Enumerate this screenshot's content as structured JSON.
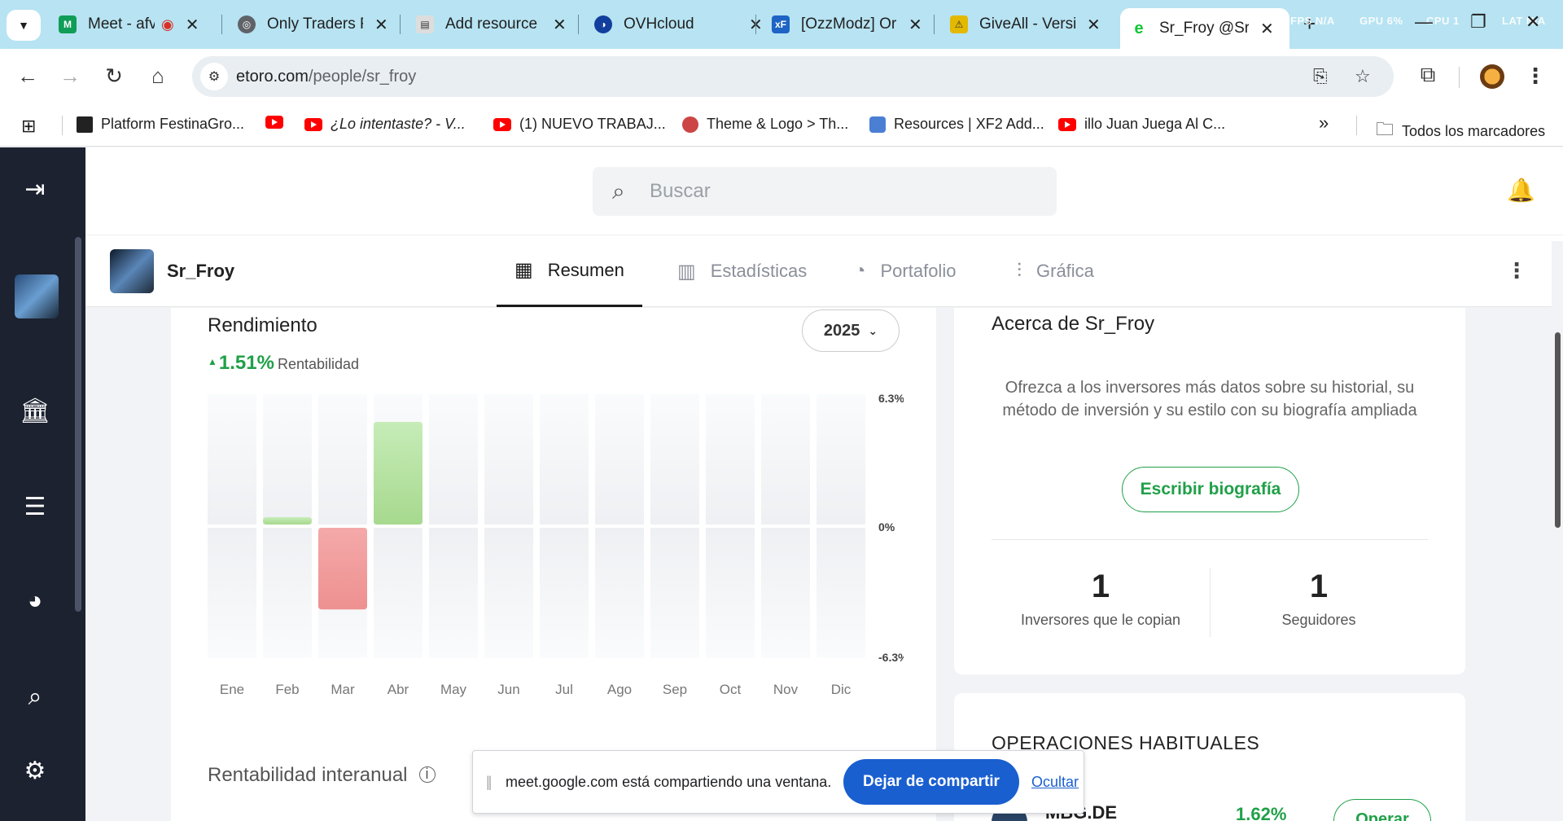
{
  "browser": {
    "tabs": [
      {
        "title": "Meet - afv",
        "color": "#0f9d58"
      },
      {
        "title": "Only Traders F",
        "color": "#5f6368"
      },
      {
        "title": "Add resource",
        "color": "#888888"
      },
      {
        "title": "OVHcloud",
        "color": "#123f9e"
      },
      {
        "title": "[OzzModz] Or",
        "color": "#1d64c4"
      },
      {
        "title": "GiveAll - Versi",
        "color": "#e3b900"
      },
      {
        "title": "Sr_Froy @Sr_F",
        "color": "#13c636"
      }
    ],
    "hud": {
      "fps": "FPS N/A",
      "gpu": "GPU  6%",
      "cpu": "CPU  1",
      "lat": "LAT N/A"
    },
    "url_host": "etoro.com",
    "url_path": "/people/sr_froy",
    "bookmarks": [
      "Platform FestinaGro...",
      "¿Lo intentaste? - V...",
      "(1) NUEVO TRABAJ...",
      "Theme & Logo > Th...",
      "Resources | XF2 Add...",
      "illo Juan Juega Al C..."
    ],
    "all_bookmarks": "Todos los marcadores",
    "overflow": "»"
  },
  "app": {
    "search_placeholder": "Buscar",
    "profile_name": "Sr_Froy",
    "tabs": [
      {
        "label": "Resumen",
        "icon": "dashboard-icon"
      },
      {
        "label": "Estadísticas",
        "icon": "bar-stats-icon"
      },
      {
        "label": "Portafolio",
        "icon": "pie-icon"
      },
      {
        "label": "Gráfica",
        "icon": "candles-icon"
      }
    ]
  },
  "performance": {
    "title": "Rendimiento",
    "return_value": "1.51%",
    "return_label": "Rentabilidad",
    "year": "2025",
    "sub_title": "Rentabilidad interanual"
  },
  "chart_data": {
    "type": "bar",
    "categories": [
      "Ene",
      "Feb",
      "Mar",
      "Abr",
      "May",
      "Jun",
      "Jul",
      "Ago",
      "Sep",
      "Oct",
      "Nov",
      "Dic"
    ],
    "values": [
      null,
      0.35,
      -3.9,
      4.9,
      null,
      null,
      null,
      null,
      null,
      null,
      null,
      null
    ],
    "ylim": [
      -6.3,
      6.3
    ],
    "yticks": [
      "6.3%",
      "0%",
      "-6.3%"
    ],
    "positive_color": "#b8e6a8",
    "negative_color": "#f09a9a"
  },
  "about": {
    "title": "Acerca de Sr_Froy",
    "description": "Ofrezca a los inversores más datos sobre su historial, su método de inversión y su estilo con su biografía ampliada",
    "bio_button": "Escribir biografía",
    "copiers_count": "1",
    "copiers_label": "Inversores que le copian",
    "followers_count": "1",
    "followers_label": "Seguidores"
  },
  "operations": {
    "title": "OPERACIONES HABITUALES",
    "symbol": "MBG.DE",
    "pct": "1.62%",
    "button": "Operar"
  },
  "share": {
    "text": "meet.google.com está compartiendo una ventana.",
    "stop": "Dejar de compartir",
    "hide": "Ocultar"
  }
}
